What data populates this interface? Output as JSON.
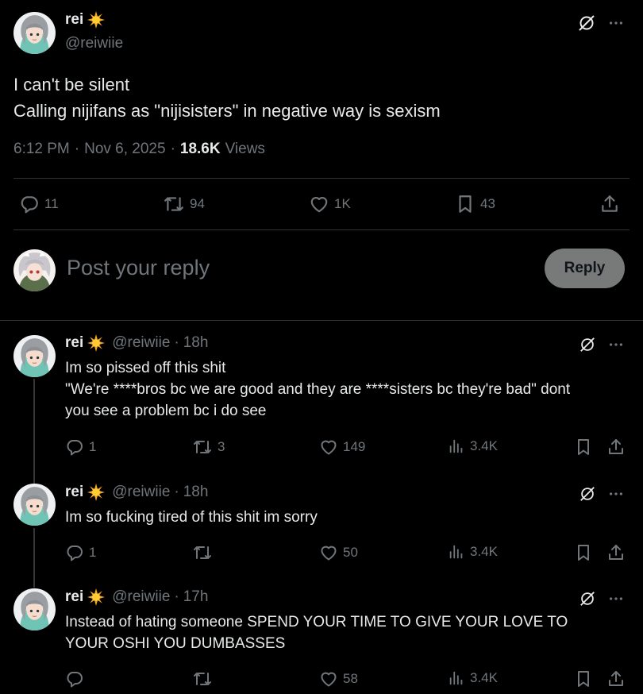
{
  "post": {
    "author_name": "rei",
    "author_handle": "@reiwiie",
    "text_line1": "I can't be silent",
    "text_line2": "Calling nijifans as \"nijisisters\" in negative way is sexism",
    "time": "6:12 PM",
    "date": "Nov 6, 2025",
    "views_count": "18.6K",
    "views_label": "Views",
    "replies": "11",
    "reposts": "94",
    "likes": "1K",
    "bookmarks": "43"
  },
  "composer": {
    "placeholder": "Post your reply",
    "reply_button": "Reply"
  },
  "replies": [
    {
      "name": "rei",
      "handle": "@reiwiie",
      "sep": "·",
      "age": "18h",
      "text": "Im so pissed off this shit\n\"We're ****bros bc we are good and they are ****sisters bc they're bad\" dont\nyou see a problem bc i do see",
      "replies": "1",
      "reposts": "3",
      "likes": "149",
      "views": "3.4K"
    },
    {
      "name": "rei",
      "handle": "@reiwiie",
      "sep": "·",
      "age": "18h",
      "text": "Im so fucking tired of this shit im sorry",
      "replies": "1",
      "reposts": "",
      "likes": "50",
      "views": "3.4K"
    },
    {
      "name": "rei",
      "handle": "@reiwiie",
      "sep": "·",
      "age": "17h",
      "text": "Instead of hating someone SPEND YOUR TIME TO GIVE YOUR LOVE TO\nYOUR OSHI YOU DUMBASSES",
      "replies": "",
      "reposts": "",
      "likes": "58",
      "views": "3.4K"
    }
  ],
  "icons": {
    "sun": "sun-emoji",
    "grok": "grok-icon",
    "more": "more-icon",
    "reply": "reply-icon",
    "repost": "repost-icon",
    "like": "heart-icon",
    "bookmark": "bookmark-icon",
    "share": "share-icon",
    "views": "views-icon"
  },
  "colors": {
    "background": "#000000",
    "text": "#e7e9ea",
    "muted": "#71767b",
    "divider": "#2f3336",
    "reply_button": "#787a7a"
  }
}
